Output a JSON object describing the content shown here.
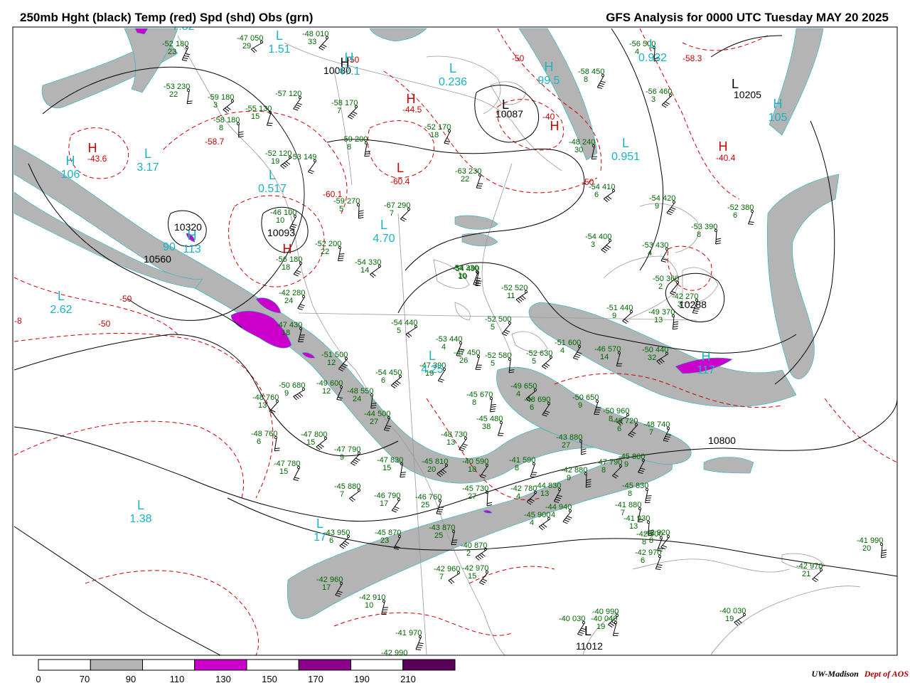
{
  "header": {
    "left_title": "250mb Hght (black) Temp (red) Spd (shd) Obs (grn)",
    "right_title": "GFS Analysis for 0000 UTC Tuesday  MAY 20 2025"
  },
  "colors": {
    "height": "#000000",
    "temperature": "#cc0000",
    "obs": "#006600",
    "centers": "#19b3c4",
    "speed_70_90": "#b4b4b4",
    "speed_90_110": "#ffffff",
    "speed_110_130": "#cc00cc",
    "speed_130_150": "#ffffff",
    "speed_150_170": "#8c008c",
    "speed_170_190": "#ffffff",
    "speed_190_210": "#5a005a",
    "geography": "#999999"
  },
  "colorbar": {
    "ticks": [
      "0",
      "70",
      "90",
      "110",
      "130",
      "150",
      "170",
      "190",
      "210"
    ],
    "segment_colors": [
      "#ffffff",
      "#b4b4b4",
      "#ffffff",
      "#cc00cc",
      "#ffffff",
      "#8c008c",
      "#ffffff",
      "#5a005a"
    ]
  },
  "credit": {
    "org": "UW-Madison",
    "dept": "Dept of AOS"
  },
  "height_labels": [
    "10080",
    "10205",
    "10320",
    "10560",
    "10093",
    "10087",
    "10288",
    "10800",
    "11012"
  ],
  "temp_labels": [
    "-50",
    "-50",
    "-50",
    "-50",
    "-58.3",
    "-44.5",
    "-60.1",
    "-60.4",
    "-43.6",
    "-58.7",
    "-40.4",
    "-40",
    "-50",
    "-8"
  ],
  "centers": [
    {
      "letter": "L",
      "value": "1.51"
    },
    {
      "letter": "H",
      "value": "47.1"
    },
    {
      "letter": "L",
      "value": "0.236"
    },
    {
      "letter": "H",
      "value": "99.5"
    },
    {
      "letter": "L",
      "value": "0.932"
    },
    {
      "letter": "H",
      "value": "105"
    },
    {
      "letter": "H",
      "value": "106"
    },
    {
      "letter": "L",
      "value": "3.17"
    },
    {
      "letter": "L",
      "value": "0.517"
    },
    {
      "letter": "L",
      "value": "4.70"
    },
    {
      "letter": "L",
      "value": "0.951"
    },
    {
      "letter": "L",
      "value": "2.62"
    },
    {
      "letter": "H",
      "value": "113"
    },
    {
      "letter": "H",
      "value": "117"
    },
    {
      "letter": "L",
      "value": "1.38"
    },
    {
      "letter": "L",
      "value": "17"
    },
    {
      "letter": "L",
      "value": "7.82"
    },
    {
      "letter": "",
      "value": "90"
    },
    {
      "letter": "L",
      "value": "4.25"
    }
  ],
  "pressure_centers": [
    {
      "letter": "H",
      "color": "black"
    },
    {
      "letter": "H",
      "color": "red"
    },
    {
      "letter": "H",
      "color": "red"
    },
    {
      "letter": "H",
      "color": "red"
    },
    {
      "letter": "L",
      "color": "red"
    },
    {
      "letter": "H",
      "color": "red"
    },
    {
      "letter": "H",
      "color": "red"
    },
    {
      "letter": "L",
      "color": "black"
    },
    {
      "letter": "L",
      "color": "black"
    },
    {
      "letter": "L",
      "color": "black"
    }
  ],
  "observations": [
    {
      "t": "-47",
      "z": "050",
      "d": "29"
    },
    {
      "t": "-48",
      "z": "010",
      "d": "33"
    },
    {
      "t": "-52",
      "z": "180",
      "d": "23"
    },
    {
      "t": "-53",
      "z": "230",
      "d": "22"
    },
    {
      "t": "-59",
      "z": "180",
      "d": "3"
    },
    {
      "t": "-57",
      "z": "120",
      "d": ""
    },
    {
      "t": "-55",
      "z": "130",
      "d": "15"
    },
    {
      "t": "-58",
      "z": "180",
      "d": "8"
    },
    {
      "t": "-58",
      "z": "170",
      "d": "7"
    },
    {
      "t": "-52",
      "z": "170",
      "d": "18"
    },
    {
      "t": "-59",
      "z": "200",
      "d": "8"
    },
    {
      "t": "-52",
      "z": "120",
      "d": "19"
    },
    {
      "t": "-53",
      "z": "149",
      "d": ""
    },
    {
      "t": "-63",
      "z": "230",
      "d": "22"
    },
    {
      "t": "-59",
      "z": "270",
      "d": "5"
    },
    {
      "t": "-67",
      "z": "290",
      "d": "7"
    },
    {
      "t": "-46",
      "z": "100",
      "d": "10"
    },
    {
      "t": "-52",
      "z": "200",
      "d": "22"
    },
    {
      "t": "-54",
      "z": "330",
      "d": "14"
    },
    {
      "t": "-56",
      "z": "180",
      "d": "18"
    },
    {
      "t": "-54",
      "z": "330",
      "d": "10"
    },
    {
      "t": "-56",
      "z": "500",
      "d": "4"
    },
    {
      "t": "-56",
      "z": "460",
      "d": "3"
    },
    {
      "t": "-58",
      "z": "450",
      "d": "8"
    },
    {
      "t": "-48",
      "z": "240",
      "d": "30"
    },
    {
      "t": "-54",
      "z": "410",
      "d": "6"
    },
    {
      "t": "-54",
      "z": "420",
      "d": "9"
    },
    {
      "t": "-52",
      "z": "380",
      "d": "6"
    },
    {
      "t": "-53",
      "z": "390",
      "d": "8"
    },
    {
      "t": "-54",
      "z": "400",
      "d": "3"
    },
    {
      "t": "-53",
      "z": "430",
      "d": "4"
    },
    {
      "t": "-54",
      "z": "490",
      "d": "10"
    },
    {
      "t": "-52",
      "z": "520",
      "d": "11"
    },
    {
      "t": "-50",
      "z": "360",
      "d": "2"
    },
    {
      "t": "-42",
      "z": "270",
      "d": "3"
    },
    {
      "t": "-49",
      "z": "370",
      "d": "13"
    },
    {
      "t": "-51",
      "z": "440",
      "d": "9"
    },
    {
      "t": "-42",
      "z": "280",
      "d": "24"
    },
    {
      "t": "-47",
      "z": "430",
      "d": "18"
    },
    {
      "t": "-54",
      "z": "440",
      "d": "5"
    },
    {
      "t": "-52",
      "z": "500",
      "d": "5"
    },
    {
      "t": "-53",
      "z": "440",
      "d": "4"
    },
    {
      "t": "-52",
      "z": "580",
      "d": "5"
    },
    {
      "t": "-52",
      "z": "630",
      "d": "5"
    },
    {
      "t": "-51",
      "z": "600",
      "d": "4"
    },
    {
      "t": "-46",
      "z": "570",
      "d": "14"
    },
    {
      "t": "-50",
      "z": "440",
      "d": "32"
    },
    {
      "t": "-51",
      "z": "500",
      "d": "12"
    },
    {
      "t": "-49",
      "z": "600",
      "d": "12"
    },
    {
      "t": "-48",
      "z": "550",
      "d": "24"
    },
    {
      "t": "-54",
      "z": "450",
      "d": "6"
    },
    {
      "t": "-47",
      "z": "390",
      "d": "19"
    },
    {
      "t": "-47",
      "z": "450",
      "d": "26"
    },
    {
      "t": "-50",
      "z": "680",
      "d": "9"
    },
    {
      "t": "-48",
      "z": "760",
      "d": "13"
    },
    {
      "t": "-44",
      "z": "500",
      "d": "27"
    },
    {
      "t": "-45",
      "z": "670",
      "d": "8"
    },
    {
      "t": "-49",
      "z": "650",
      "d": "4"
    },
    {
      "t": "-48",
      "z": "690",
      "d": "6"
    },
    {
      "t": "-50",
      "z": "650",
      "d": "9"
    },
    {
      "t": "-50",
      "z": "960",
      "d": "8"
    },
    {
      "t": "-49",
      "z": "720",
      "d": "6"
    },
    {
      "t": "-48",
      "z": "740",
      "d": "7"
    },
    {
      "t": "-48",
      "z": "760",
      "d": "6"
    },
    {
      "t": "-47",
      "z": "800",
      "d": "15"
    },
    {
      "t": "-48",
      "z": "730",
      "d": "13"
    },
    {
      "t": "-45",
      "z": "480",
      "d": "38"
    },
    {
      "t": "-43",
      "z": "880",
      "d": "27"
    },
    {
      "t": "-47",
      "z": "790",
      "d": "9"
    },
    {
      "t": "-47",
      "z": "780",
      "d": "15"
    },
    {
      "t": "-47",
      "z": "830",
      "d": "15"
    },
    {
      "t": "-45",
      "z": "810",
      "d": "20"
    },
    {
      "t": "-40",
      "z": "590",
      "d": "18"
    },
    {
      "t": "-41",
      "z": "590",
      "d": "8"
    },
    {
      "t": "-42",
      "z": "880",
      "d": "9"
    },
    {
      "t": "-47",
      "z": "790",
      "d": "8"
    },
    {
      "t": "-45",
      "z": "860",
      "d": "9"
    },
    {
      "t": "-45",
      "z": "830",
      "d": "8"
    },
    {
      "t": "-45",
      "z": "880",
      "d": "7"
    },
    {
      "t": "-46",
      "z": "790",
      "d": "17"
    },
    {
      "t": "-46",
      "z": "760",
      "d": "25"
    },
    {
      "t": "-45",
      "z": "730",
      "d": "27"
    },
    {
      "t": "-42",
      "z": "780",
      "d": "4"
    },
    {
      "t": "-44",
      "z": "830",
      "d": "13"
    },
    {
      "t": "-41",
      "z": "880",
      "d": "7"
    },
    {
      "t": "-45",
      "z": "900",
      "d": "4"
    },
    {
      "t": "-44",
      "z": "940",
      "d": "4"
    },
    {
      "t": "-42",
      "z": "900",
      "d": "8"
    },
    {
      "t": "-41",
      "z": "930",
      "d": "13"
    },
    {
      "t": "-43",
      "z": "950",
      "d": "6"
    },
    {
      "t": "-45",
      "z": "870",
      "d": "23"
    },
    {
      "t": "-43",
      "z": "870",
      "d": "25"
    },
    {
      "t": "-40",
      "z": "870",
      "d": "2"
    },
    {
      "t": "-42",
      "z": "920",
      "d": "8"
    },
    {
      "t": "-42",
      "z": "970",
      "d": "6"
    },
    {
      "t": "-41",
      "z": "990",
      "d": "20"
    },
    {
      "t": "-42",
      "z": "970",
      "d": "21"
    },
    {
      "t": "-42",
      "z": "960",
      "d": "17"
    },
    {
      "t": "-42",
      "z": "910",
      "d": "10"
    },
    {
      "t": "-42",
      "z": "960",
      "d": "7"
    },
    {
      "t": "-42",
      "z": "970",
      "d": "15"
    },
    {
      "t": "-41",
      "z": "970",
      "d": ""
    },
    {
      "t": "-42",
      "z": "990",
      "d": "16"
    },
    {
      "t": "-40",
      "z": "990",
      "d": ""
    },
    {
      "t": "-40",
      "z": "030",
      "d": ""
    },
    {
      "t": "-40",
      "z": "040",
      "d": "19"
    },
    {
      "t": "-40",
      "z": "030",
      "d": "19"
    },
    {
      "t": "-41",
      "z": "000",
      "d": "17"
    }
  ]
}
